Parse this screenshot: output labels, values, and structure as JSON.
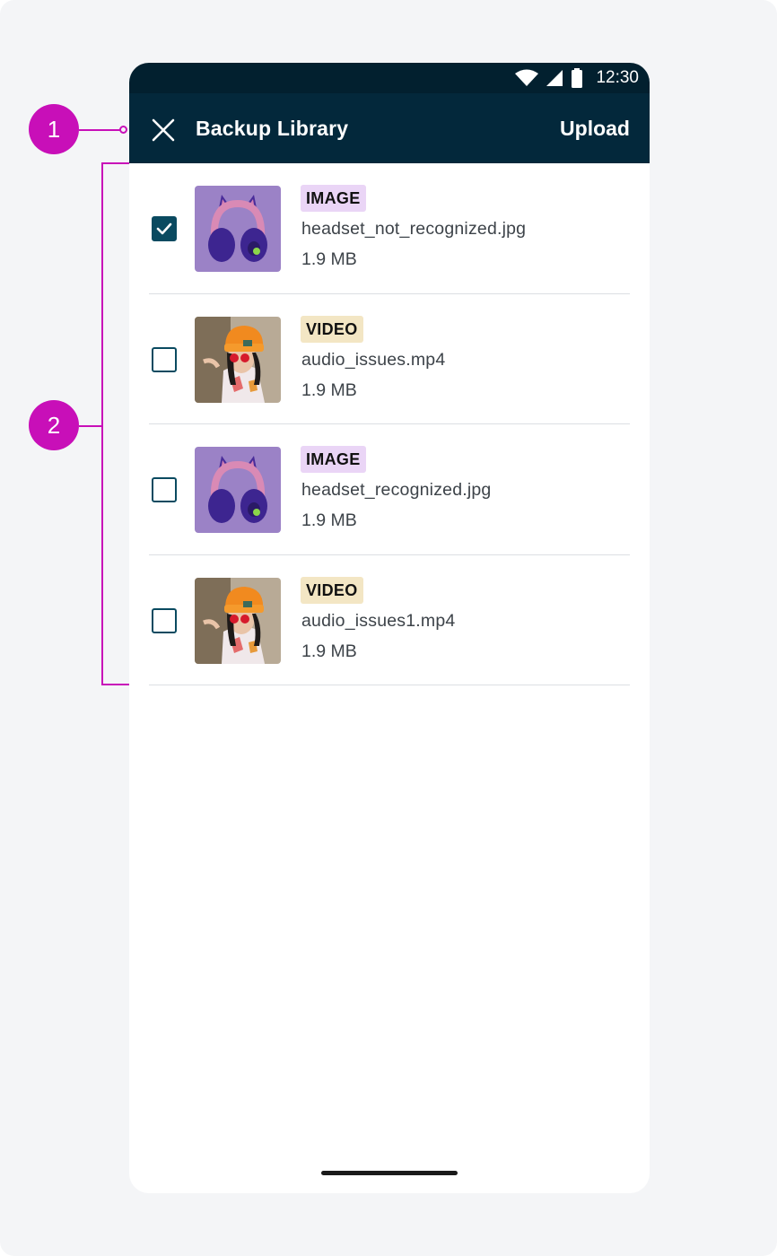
{
  "status_bar": {
    "time": "12:30"
  },
  "app_bar": {
    "title": "Backup Library",
    "upload_label": "Upload"
  },
  "files": [
    {
      "type_label": "IMAGE",
      "type": "image",
      "name": "headset_not_recognized.jpg",
      "size": "1.9 MB",
      "checked": true,
      "thumbnail": "headset-thumbnail"
    },
    {
      "type_label": "VIDEO",
      "type": "video",
      "name": "audio_issues.mp4",
      "size": "1.9 MB",
      "checked": false,
      "thumbnail": "video-thumbnail"
    },
    {
      "type_label": "IMAGE",
      "type": "image",
      "name": "headset_recognized.jpg",
      "size": "1.9 MB",
      "checked": false,
      "thumbnail": "headset-thumbnail"
    },
    {
      "type_label": "VIDEO",
      "type": "video",
      "name": "audio_issues1.mp4",
      "size": "1.9 MB",
      "checked": false,
      "thumbnail": "video-thumbnail"
    }
  ],
  "callouts": {
    "first": "1",
    "second": "2"
  },
  "colors": {
    "app_bar": "#03283b",
    "status_bar": "#02202f",
    "accent": "#0a4a60",
    "callout": "#c80fb8",
    "image_tag": "#ead5f6",
    "video_tag": "#f3e6c4"
  }
}
